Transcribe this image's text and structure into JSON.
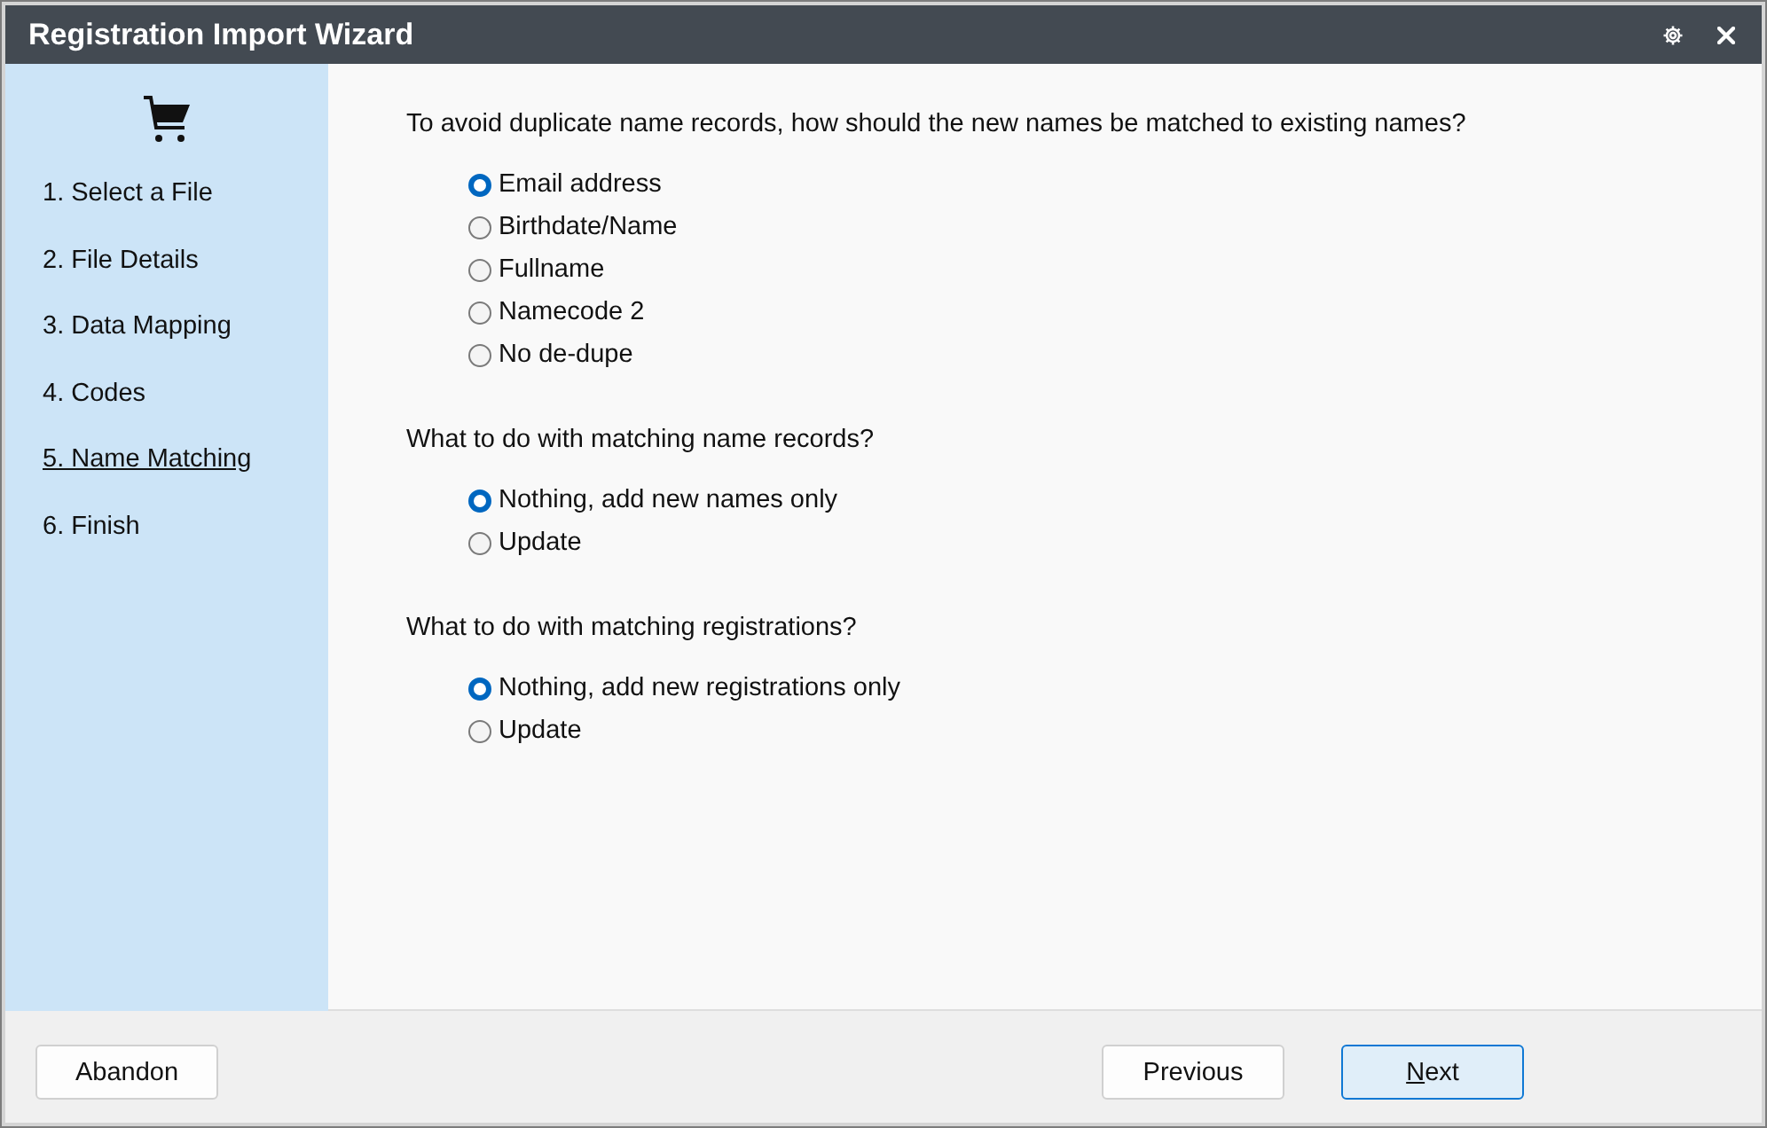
{
  "window": {
    "title": "Registration Import Wizard"
  },
  "sidebar": {
    "steps": [
      {
        "label": "1. Select a File",
        "selected": false
      },
      {
        "label": "2. File Details",
        "selected": false
      },
      {
        "label": "3. Data Mapping",
        "selected": false
      },
      {
        "label": "4. Codes",
        "selected": false
      },
      {
        "label": "5. Name Matching",
        "selected": true
      },
      {
        "label": "6. Finish",
        "selected": false
      }
    ]
  },
  "questions": [
    {
      "prompt": "To avoid duplicate name records, how should the new names be matched to existing names?",
      "options": [
        {
          "label": "Email address",
          "selected": true
        },
        {
          "label": "Birthdate/Name",
          "selected": false
        },
        {
          "label": "Fullname",
          "selected": false
        },
        {
          "label": "Namecode 2",
          "selected": false
        },
        {
          "label": "No de-dupe",
          "selected": false
        }
      ]
    },
    {
      "prompt": "What to do with matching name records?",
      "options": [
        {
          "label": "Nothing, add new names only",
          "selected": true
        },
        {
          "label": "Update",
          "selected": false
        }
      ]
    },
    {
      "prompt": "What to do with matching registrations?",
      "options": [
        {
          "label": "Nothing, add new registrations only",
          "selected": true
        },
        {
          "label": "Update",
          "selected": false
        }
      ]
    }
  ],
  "footer": {
    "left_buttons": [
      {
        "label": "Abandon",
        "default": false,
        "underline_first_letter": false
      }
    ],
    "right_buttons": [
      {
        "label": "Previous",
        "default": false,
        "underline_first_letter": false
      },
      {
        "label": "Next",
        "default": true,
        "underline_first_letter": true
      }
    ]
  }
}
